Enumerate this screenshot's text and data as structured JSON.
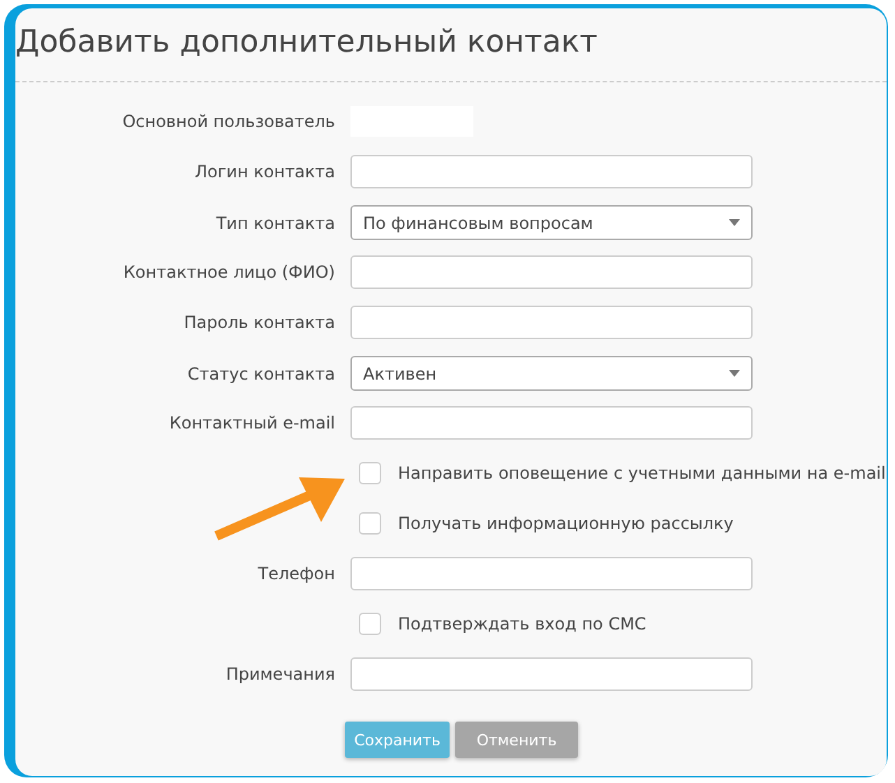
{
  "title": "Добавить дополнительный контакт",
  "fields": [
    {
      "kind": "static",
      "label": "Основной пользователь"
    },
    {
      "kind": "text",
      "label": "Логин контакта"
    },
    {
      "kind": "select",
      "label": "Тип контакта",
      "value": "По финансовым вопросам"
    },
    {
      "kind": "text",
      "label": "Контактное лицо (ФИО)"
    },
    {
      "kind": "text",
      "label": "Пароль контакта"
    },
    {
      "kind": "select",
      "label": "Статус контакта",
      "value": "Активен"
    },
    {
      "kind": "text",
      "label": "Контактный e-mail"
    },
    {
      "kind": "checkbox",
      "label": "Направить оповещение с учетными данными на e-mail",
      "checked": false
    },
    {
      "kind": "checkbox",
      "label": "Получать информационную рассылку",
      "checked": false
    },
    {
      "kind": "text",
      "label": "Телефон"
    },
    {
      "kind": "checkbox",
      "label": "Подтверждать вход по СМС",
      "checked": false
    },
    {
      "kind": "text",
      "label": "Примечания"
    }
  ],
  "buttons": [
    {
      "label": "Сохранить",
      "kind": "primary"
    },
    {
      "label": "Отменить",
      "kind": "secondary"
    }
  ]
}
